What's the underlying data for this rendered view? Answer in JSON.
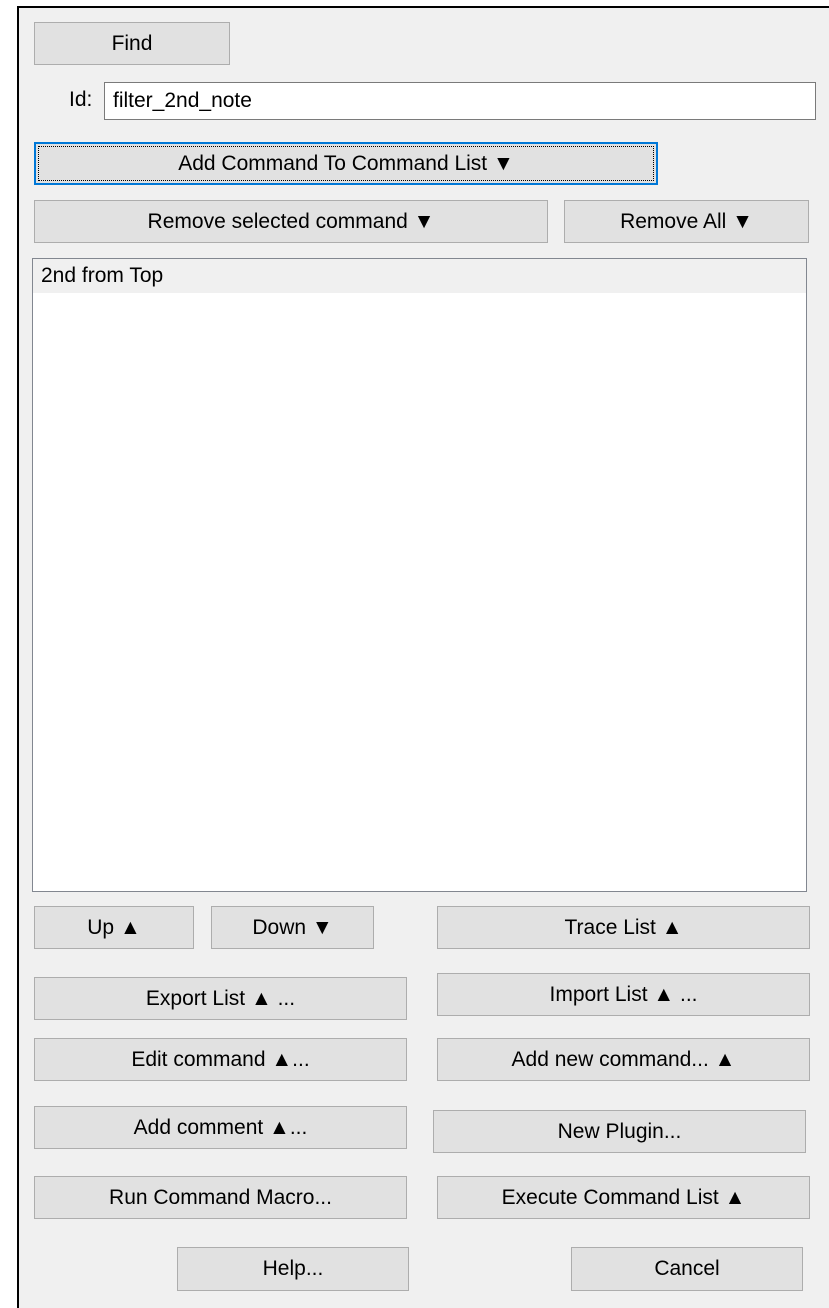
{
  "find_button": "Find",
  "id_field": {
    "label": "Id:",
    "value": "filter_2nd_note"
  },
  "buttons": {
    "add_command": "Add Command To Command List ▼",
    "remove_selected": "Remove selected command ▼",
    "remove_all": "Remove All ▼",
    "up": "Up ▲",
    "down": "Down ▼",
    "trace_list": "Trace List ▲",
    "export_list": "Export List ▲ ...",
    "import_list": "Import List ▲ ...",
    "edit_command": "Edit command ▲...",
    "add_new_command": "Add new command... ▲",
    "add_comment": "Add comment ▲...",
    "new_plugin": "New Plugin...",
    "run_macro": "Run Command Macro...",
    "execute_list": "Execute Command List ▲",
    "help": "Help...",
    "cancel": "Cancel"
  },
  "command_list": {
    "items": [
      {
        "label": "2nd from Top"
      }
    ]
  }
}
